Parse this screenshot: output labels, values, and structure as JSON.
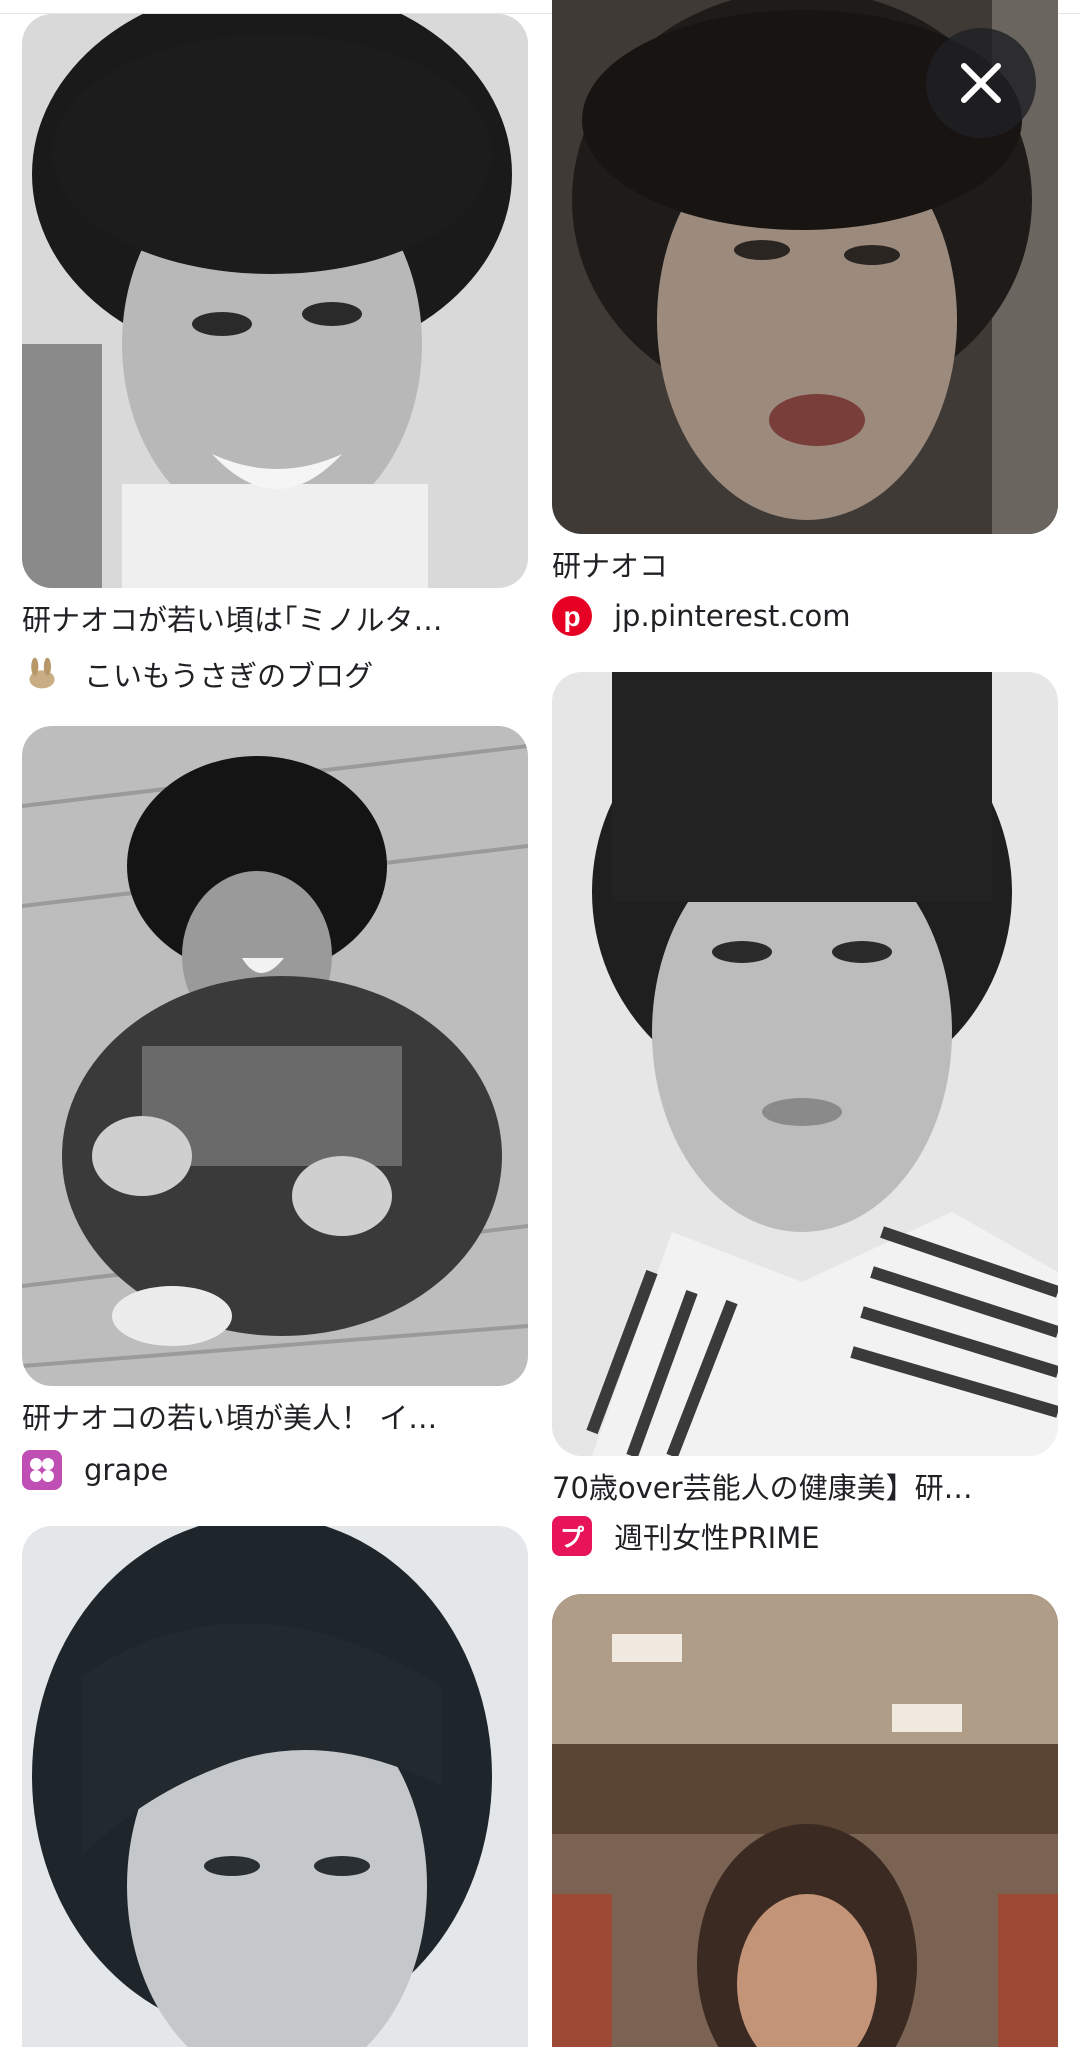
{
  "results": [
    {
      "caption": "研ナオコが若い頃は｢ミノルタ…",
      "source": "こいもうさぎのブログ",
      "source_icon": "rabbit-icon"
    },
    {
      "caption": "研ナオコ",
      "source": "jp.pinterest.com",
      "source_icon": "pinterest-icon"
    },
    {
      "caption": "研ナオコの若い頃が美人！ イ…",
      "source": "grape",
      "source_icon": "grape-icon"
    },
    {
      "caption": "70歳over芸能人の健康美】研…",
      "source": "週刊女性PRIME",
      "source_icon": "prime-icon"
    }
  ],
  "photo_caption_small": "",
  "colors": {
    "pinterest": "#e60023",
    "grape": "#c04fb4",
    "prime": "#e8145a",
    "close_bg": "#202124"
  },
  "close_button": {
    "icon": "close-icon"
  }
}
